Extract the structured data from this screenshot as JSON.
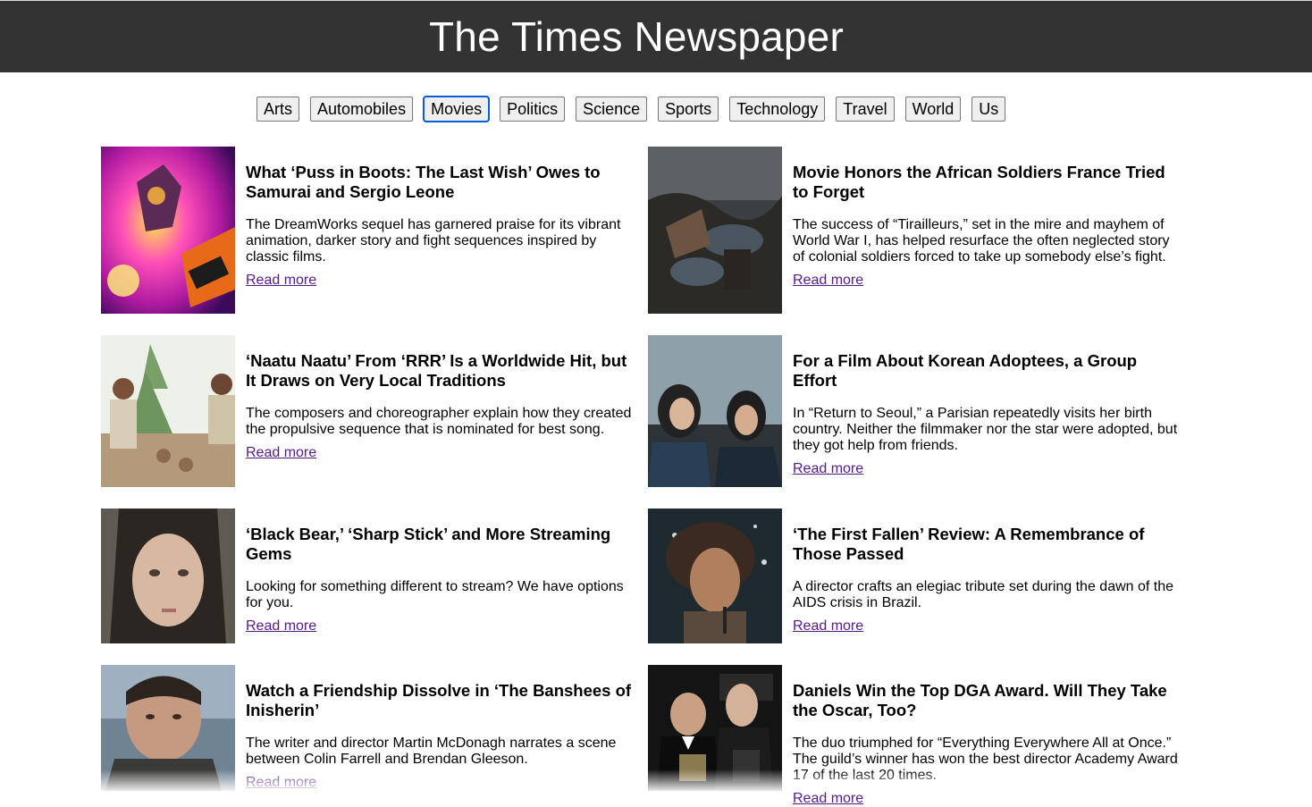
{
  "header": {
    "title": "The Times Newspaper"
  },
  "nav": {
    "items": [
      "Arts",
      "Automobiles",
      "Movies",
      "Politics",
      "Science",
      "Sports",
      "Technology",
      "Travel",
      "World",
      "Us"
    ],
    "active": "Movies"
  },
  "articles": [
    {
      "title": "What ‘Puss in Boots: The Last Wish’ Owes to Samurai and Sergio Leone",
      "description": "The DreamWorks sequel has garnered praise for its vibrant animation, darker story and fight sequences inspired by classic films.",
      "link": "Read more"
    },
    {
      "title": "Movie Honors the African Soldiers France Tried to Forget",
      "description": "The success of “Tirailleurs,” set in the mire and mayhem of World War I, has helped resurface the often neglected story of colonial soldiers forced to take up somebody else’s fight.",
      "link": "Read more"
    },
    {
      "title": "‘Naatu Naatu’ From ‘RRR’ Is a Worldwide Hit, but It Draws on Very Local Traditions",
      "description": "The composers and choreographer explain how they created the propulsive sequence that is nominated for best song.",
      "link": "Read more"
    },
    {
      "title": "For a Film About Korean Adoptees, a Group Effort",
      "description": "In “Return to Seoul,” a Parisian repeatedly visits her birth country. Neither the filmmaker nor the star were adopted, but they got help from friends.",
      "link": "Read more"
    },
    {
      "title": "‘Black Bear,’ ‘Sharp Stick’ and More Streaming Gems",
      "description": "Looking for something different to stream? We have options for you.",
      "link": "Read more"
    },
    {
      "title": "‘The First Fallen’ Review: A Remembrance of Those Passed",
      "description": "A director crafts an elegiac tribute set during the dawn of the AIDS crisis in Brazil.",
      "link": "Read more"
    },
    {
      "title": "Watch a Friendship Dissolve in ‘The Banshees of Inisherin’",
      "description": "The writer and director Martin McDonagh narrates a scene between Colin Farrell and Brendan Gleeson.",
      "link": "Read more"
    },
    {
      "title": "Daniels Win the Top DGA Award. Will They Take the Oscar, Too?",
      "description": "The duo triumphed for “Everything Everywhere All at Once.” The guild’s winner has won the best director Academy Award 17 of the last 20 times.",
      "link": "Read more"
    }
  ],
  "colors": {
    "header_bg": "#333333",
    "link": "#551a8b",
    "active_border": "#0a5bd6"
  }
}
